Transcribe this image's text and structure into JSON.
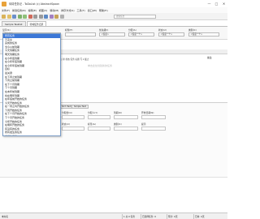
{
  "window": {
    "title": "待将任务记 - ToDoList (c) AbstractSpoon"
  },
  "window_buttons": [
    "—",
    "□",
    "✕"
  ],
  "menu": [
    "文件(F)",
    "新建任务(N)",
    "编辑(E)",
    "视图(V)",
    "移动(M)",
    "排序方式(S)",
    "工具(T)",
    "窗口(W)",
    "帮助(H)"
  ],
  "search": {
    "placeholder": "搜索任务"
  },
  "tabs": [
    "Sample Tasklist",
    "待将任务记录"
  ],
  "filters": [
    {
      "label": "显示(S)",
      "value": "所有任务"
    },
    {
      "label": "标题(T)",
      "value": ""
    },
    {
      "label": "优先级(I)",
      "value": "<任意>"
    },
    {
      "label": "分配(A)",
      "value": "<任意一个>"
    },
    {
      "label": "状态(U)",
      "value": "<任意一个>"
    },
    {
      "label": "类别(C)",
      "value": "<任意一个>"
    }
  ],
  "main": {
    "sort_text": "标 | 排  状态  任务 标题  写 ▾ 截止",
    "hint": "单击此处创建新的任务",
    "right_label": "备注"
  },
  "dropdown": {
    "selected_index": 0,
    "items": [
      "所有任务",
      "不完全",
      "完成的任务",
      "当今以前到期",
      "今天到期任务",
      "明天到期任务",
      "在今年底到期",
      "在今年年底到期",
      "在今年年底前到期",
      "目标",
      "最关键",
      "在下周之前到期",
      "下周之前到期",
      "在下个月到期",
      "下个月到期",
      "在本年前到期",
      "将在明年到期",
      "在年底前开始的任务",
      "今天开始的任务",
      "在一周之内开始的任务",
      "下周开始的任务",
      "在下个月开始的任务",
      "下个月开始的任务",
      "今年开始的任务",
      "在明年开始的任务",
      "有没有的任务",
      "所有发生的任务",
      "标记的任务",
      "过滤的任务"
    ]
  },
  "editor": {
    "tabs": [
      "Rich Text",
      "Simple Text"
    ],
    "fields": [
      {
        "label": "分配给(O)",
        "value": ""
      },
      {
        "label": "分配人(Y)",
        "value": ""
      },
      {
        "label": "到期(D)",
        "value": ""
      },
      {
        "label": "开始日期(N)",
        "value": ""
      },
      {
        "label": "状态(U)",
        "value": ""
      },
      {
        "label": "标签(G)",
        "value": ""
      },
      {
        "label": "类别(C)",
        "value": ""
      },
      {
        "label": "提示",
        "value": ""
      }
    ]
  },
  "statusbar": {
    "file": "未命名",
    "selection": "1 共 0 任务",
    "completed": "已选择任务: 0",
    "estimate": "预计: 0天",
    "spent": "已用: 0天"
  },
  "colors": {
    "accent": "#3c77d7",
    "border": "#7a9cc6"
  }
}
